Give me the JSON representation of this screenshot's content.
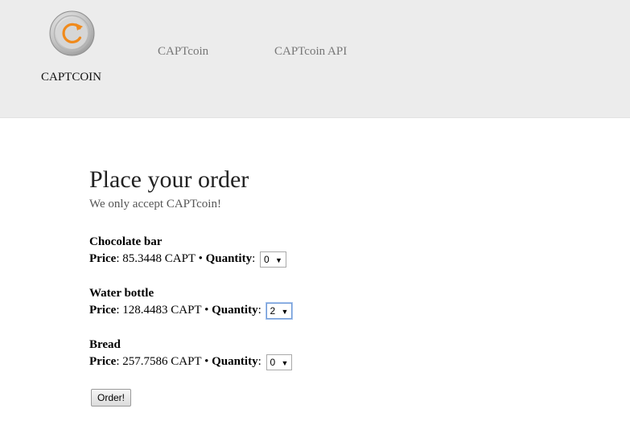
{
  "header": {
    "brand": "CAPTCOIN",
    "nav": [
      {
        "label": "CAPTcoin"
      },
      {
        "label": "CAPTcoin API"
      }
    ],
    "logo_icon": "captcoin-logo-icon",
    "colors": {
      "accent": "#f08a1c",
      "coin": "#c8c8c8"
    }
  },
  "main": {
    "title": "Place your order",
    "subtitle": "We only accept CAPTcoin!",
    "price_label": "Price",
    "quantity_label": "Quantity",
    "separator": "•",
    "items": [
      {
        "name": "Chocolate bar",
        "price": "85.3448 CAPT",
        "quantity": "0"
      },
      {
        "name": "Water bottle",
        "price": "128.4483 CAPT",
        "quantity": "2"
      },
      {
        "name": "Bread",
        "price": "257.7586 CAPT",
        "quantity": "0"
      }
    ],
    "order_button": "Order!"
  }
}
